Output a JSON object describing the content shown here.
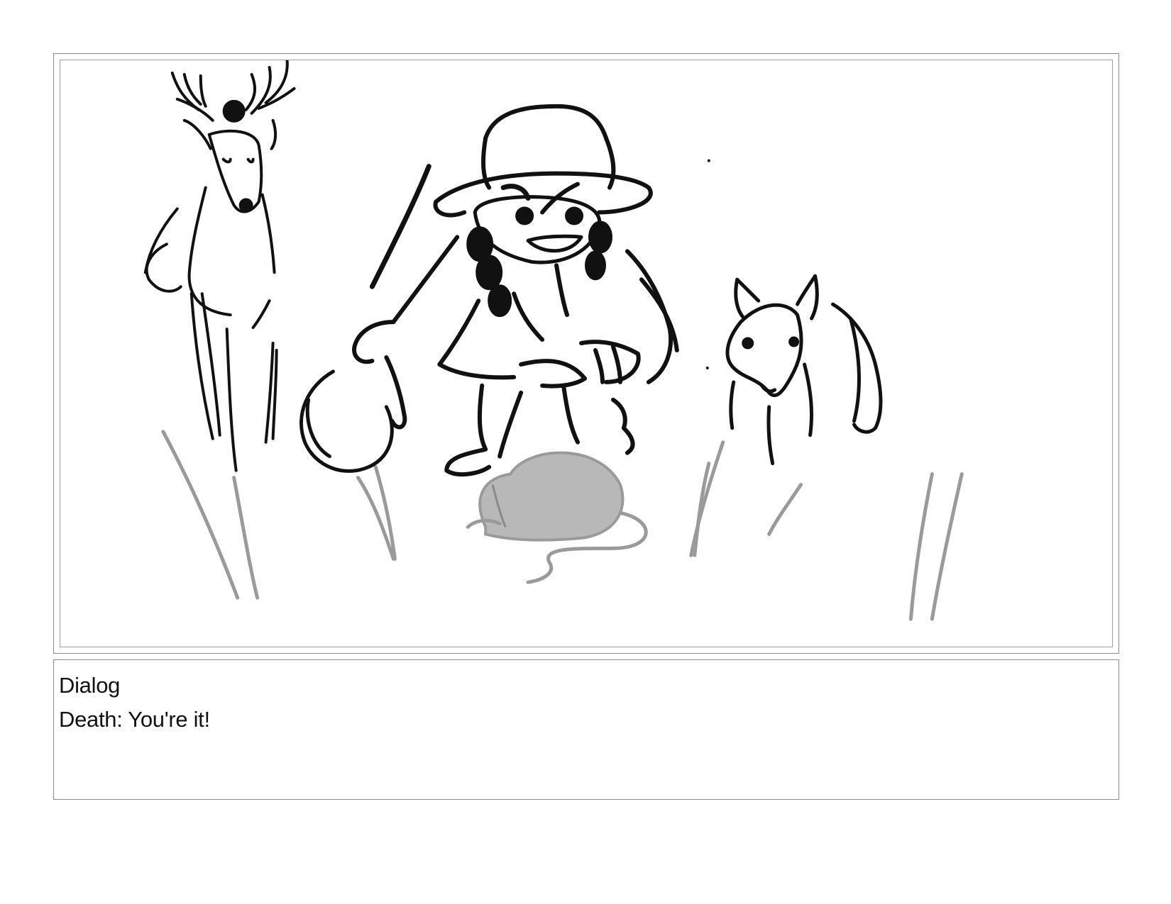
{
  "storyboard": {
    "panel": {
      "image_subject": "sketch-girl-deer-dog-mouse"
    },
    "dialog": {
      "heading": "Dialog",
      "line": "Death: You're it!"
    }
  }
}
